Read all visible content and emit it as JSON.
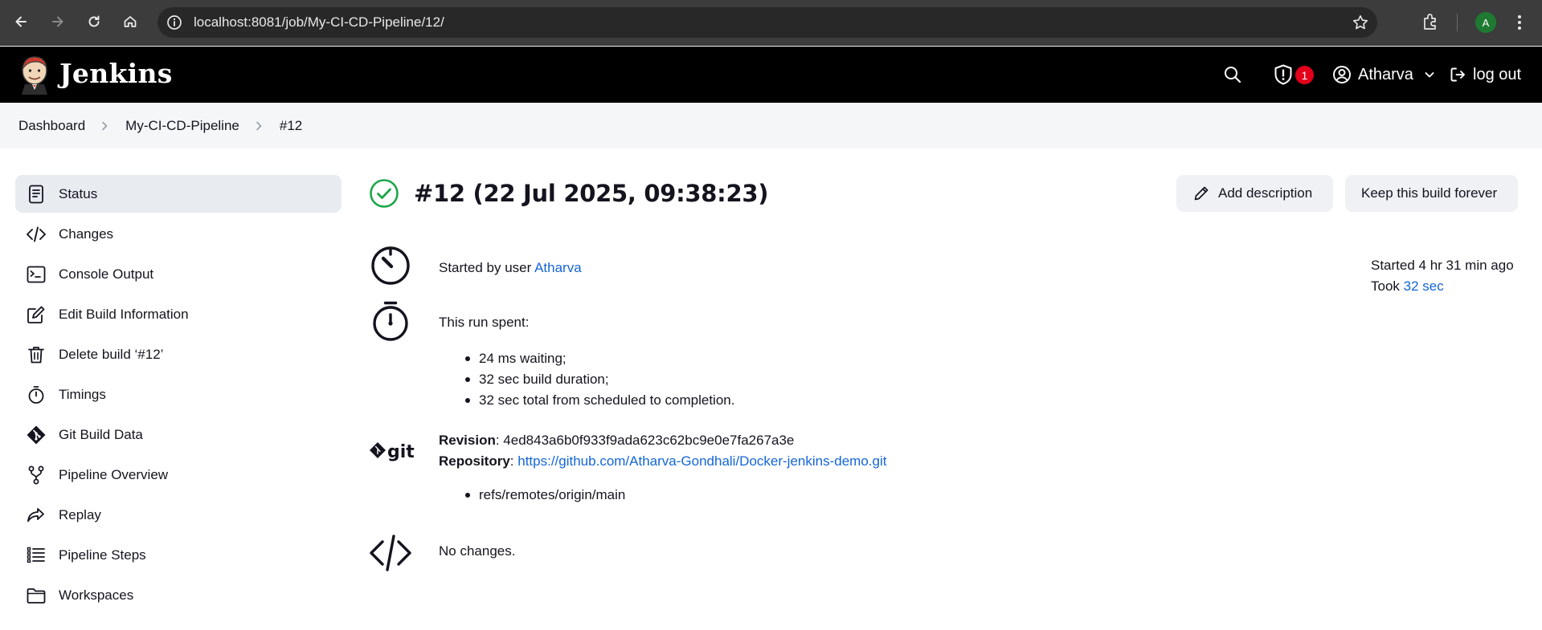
{
  "browser": {
    "url": "localhost:8081/job/My-CI-CD-Pipeline/12/",
    "profile_initial": "A"
  },
  "header": {
    "brand": "Jenkins",
    "security_count": "1",
    "user": "Atharva",
    "logout": "log out"
  },
  "breadcrumbs": [
    "Dashboard",
    "My-CI-CD-Pipeline",
    "#12"
  ],
  "sidebar": {
    "items": [
      {
        "label": "Status",
        "icon": "status-icon"
      },
      {
        "label": "Changes",
        "icon": "code-icon"
      },
      {
        "label": "Console Output",
        "icon": "terminal-icon"
      },
      {
        "label": "Edit Build Information",
        "icon": "edit-icon"
      },
      {
        "label": "Delete build ‘#12’",
        "icon": "trash-icon"
      },
      {
        "label": "Timings",
        "icon": "stopwatch-icon"
      },
      {
        "label": "Git Build Data",
        "icon": "git-icon"
      },
      {
        "label": "Pipeline Overview",
        "icon": "branch-icon"
      },
      {
        "label": "Replay",
        "icon": "replay-icon"
      },
      {
        "label": "Pipeline Steps",
        "icon": "list-icon"
      },
      {
        "label": "Workspaces",
        "icon": "folder-icon"
      }
    ]
  },
  "build": {
    "title": "#12 (22 Jul 2025, 09:38:23)",
    "add_description": "Add description",
    "keep_forever": "Keep this build forever",
    "started_by_prefix": "Started by user ",
    "started_by_user": "Atharva",
    "started_ago": "Started 4 hr 31 min ago",
    "took_prefix": "Took ",
    "took_value": "32 sec",
    "run_spent_label": "This run spent:",
    "run_spent": [
      "24 ms waiting;",
      "32 sec build duration;",
      "32 sec total from scheduled to completion."
    ],
    "revision_label": "Revision",
    "revision": ": 4ed843a6b0f933f9ada623c62bc9e0e7fa267a3e",
    "repository_label": "Repository",
    "repository_sep": ": ",
    "repository_url": "https://github.com/Atharva-Gondhali/Docker-jenkins-demo.git",
    "refs": [
      "refs/remotes/origin/main"
    ],
    "no_changes": "No changes."
  },
  "colors": {
    "success": "#1ea64b",
    "link": "#1466d6",
    "badge": "#e3001b"
  }
}
